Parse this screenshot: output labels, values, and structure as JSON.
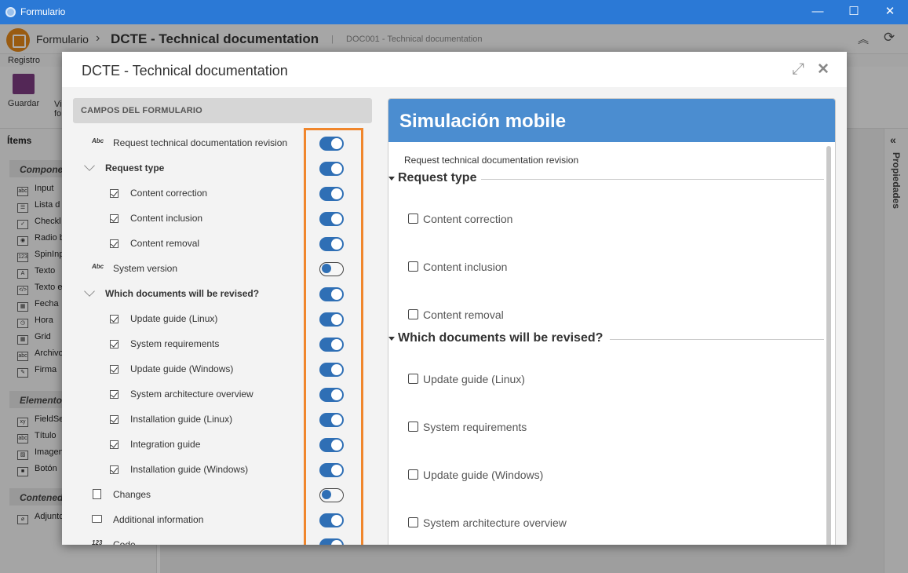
{
  "window": {
    "title": "Formulario",
    "minimize": "—",
    "maximize": "☐",
    "close": "✕"
  },
  "breadcrumb": {
    "root": "Formulario",
    "separator": "›",
    "current": "DCTE - Technical documentation",
    "divider": "|",
    "sub": "DOC001 - Technical documentation"
  },
  "ribbon": {
    "tab": "Registro",
    "save_label": "Guardar",
    "view_label_1": "Vi",
    "view_label_2": "fo"
  },
  "left_panel": {
    "title": "Ítems",
    "sections": [
      "Compone",
      "Elemento",
      "Contened"
    ],
    "components": [
      "Input",
      "Lista d",
      "Checkl",
      "Radio b",
      "SpinInp",
      "Texto",
      "Texto e",
      "Fecha",
      "Hora",
      "Grid",
      "Archivo",
      "Firma"
    ],
    "component_icons": [
      "abc",
      "☰",
      "✓",
      "◉",
      "123",
      "A",
      "</>",
      "▦",
      "◷",
      "▦",
      "abc",
      "✎"
    ],
    "elements": [
      "FieldSe",
      "Título",
      "Imagen",
      "Botón"
    ],
    "element_icons": [
      "xy",
      "abc",
      "▨",
      "■"
    ],
    "containers": [
      "Adjunto"
    ]
  },
  "right_rail": {
    "label": "Propiedades",
    "icon": "«"
  },
  "modal": {
    "title": "DCTE - Technical documentation",
    "expand_icon": "⤢",
    "close_icon": "✕",
    "fields_header": "CAMPOS DEL FORMULARIO",
    "fields": [
      {
        "label": "Request technical documentation revision",
        "kind": "abc",
        "icon_text": "Abc",
        "enabled": true
      },
      {
        "label": "Request type",
        "kind": "group",
        "enabled": true
      },
      {
        "label": "Content correction",
        "kind": "check",
        "enabled": true
      },
      {
        "label": "Content inclusion",
        "kind": "check",
        "enabled": true
      },
      {
        "label": "Content removal",
        "kind": "check",
        "enabled": true
      },
      {
        "label": "System version",
        "kind": "abc",
        "icon_text": "Abc",
        "enabled": false
      },
      {
        "label": "Which documents will be revised?",
        "kind": "group",
        "enabled": true
      },
      {
        "label": "Update guide (Linux)",
        "kind": "check",
        "enabled": true
      },
      {
        "label": "System requirements",
        "kind": "check",
        "enabled": true
      },
      {
        "label": "Update guide (Windows)",
        "kind": "check",
        "enabled": true
      },
      {
        "label": "System architecture overview",
        "kind": "check",
        "enabled": true
      },
      {
        "label": "Installation guide (Linux)",
        "kind": "check",
        "enabled": true
      },
      {
        "label": "Integration guide",
        "kind": "check",
        "enabled": true
      },
      {
        "label": "Installation guide (Windows)",
        "kind": "check",
        "enabled": true
      },
      {
        "label": "Changes",
        "kind": "doc",
        "enabled": false
      },
      {
        "label": "Additional information",
        "kind": "comment",
        "enabled": true
      },
      {
        "label": "Code",
        "kind": "num",
        "icon_text": "123",
        "enabled": true
      }
    ],
    "mobile": {
      "title": "Simulación mobile",
      "intro": "Request technical documentation revision",
      "sections": [
        {
          "title": "Request type",
          "items": [
            "Content correction",
            "Content inclusion",
            "Content removal"
          ]
        },
        {
          "title": "Which documents will be revised?",
          "items": [
            "Update guide (Linux)",
            "System requirements",
            "Update guide (Windows)",
            "System architecture overview"
          ]
        }
      ]
    }
  },
  "colors": {
    "titlebar": "#2b79d6",
    "accent": "#2f6fb5",
    "highlight": "#f0862c",
    "mobile_header": "#4b8dd0"
  }
}
